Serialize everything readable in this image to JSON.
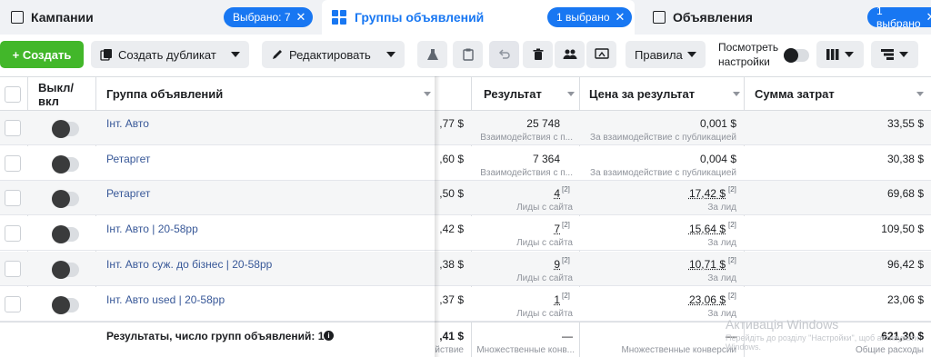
{
  "tabs": [
    {
      "label": "Кампании",
      "pill": "Выбрано: 7",
      "icon": "folder-icon"
    },
    {
      "label": "Группы объявлений",
      "pill": "1 выбрано",
      "icon": "grid-icon"
    },
    {
      "label": "Объявления",
      "pill": "1 выбрано",
      "icon": "ad-icon"
    }
  ],
  "toolbar": {
    "create": "+ Создать",
    "duplicate": "Создать дубликат",
    "edit": "Редактировать",
    "rules": "Правила",
    "view_settings_line1": "Посмотреть",
    "view_settings_line2": "настройки"
  },
  "columns": {
    "onoff_line1": "Выкл/",
    "onoff_line2": "вкл",
    "adset": "Группа объявлений",
    "result": "Результат",
    "cpr": "Цена за результат",
    "spend": "Сумма затрат"
  },
  "rows": [
    {
      "name": "Інт. Авто",
      "trunc": ",77 $",
      "result": "25 748",
      "result_sub": "Взаимодействия с п...",
      "cpr": "0,001 $",
      "cpr_sub": "За взаимодействие с публикацией",
      "spend": "33,55 $",
      "footnote": false
    },
    {
      "name": "Ретаргет",
      "trunc": ",60 $",
      "result": "7 364",
      "result_sub": "Взаимодействия с п...",
      "cpr": "0,004 $",
      "cpr_sub": "За взаимодействие с публикацией",
      "spend": "30,38 $",
      "footnote": false
    },
    {
      "name": "Ретаргет",
      "trunc": ",50 $",
      "result": "4",
      "result_sub": "Лиды с сайта",
      "cpr": "17,42 $",
      "cpr_sub": "За лид",
      "spend": "69,68 $",
      "footnote": true
    },
    {
      "name": "Інт. Авто | 20-58рр",
      "trunc": ",42 $",
      "result": "7",
      "result_sub": "Лиды с сайта",
      "cpr": "15,64 $",
      "cpr_sub": "За лид",
      "spend": "109,50 $",
      "footnote": true
    },
    {
      "name": "Інт. Авто суж. до бізнес | 20-58рр",
      "trunc": ",38 $",
      "result": "9",
      "result_sub": "Лиды с сайта",
      "cpr": "10,71 $",
      "cpr_sub": "За лид",
      "spend": "96,42 $",
      "footnote": true
    },
    {
      "name": "Інт. Авто used | 20-58рр",
      "trunc": ",37 $",
      "result": "1",
      "result_sub": "Лиды с сайта",
      "cpr": "23,06 $",
      "cpr_sub": "За лид",
      "spend": "23,06 $",
      "footnote": true
    }
  ],
  "footnote_mark": "[2]",
  "summary": {
    "label": "Результаты, число групп объявлений: 13",
    "trunc": ",41 $",
    "trunc_sub": "йствие",
    "result": "—",
    "result_sub": "Множественные конв...",
    "cpr": "—",
    "cpr_sub": "Множественные конверсии",
    "spend": "621,30 $",
    "spend_sub": "Общие расходы"
  },
  "watermark": {
    "title": "Активація Windows",
    "line2": "Перейдіть до розділу \"Настройки\", щоб активувати",
    "line3": "Windows."
  }
}
